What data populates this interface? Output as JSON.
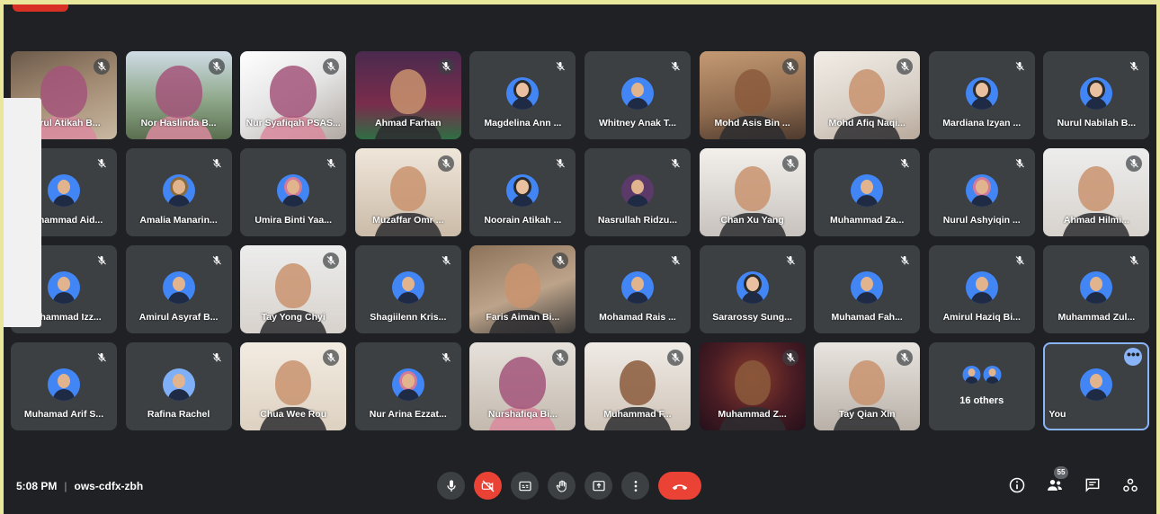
{
  "meeting": {
    "time": "5:08 PM",
    "separator": "|",
    "code": "ows-cdfx-zbh"
  },
  "participants": [
    {
      "name": "Nurul Atikah B...",
      "video": true,
      "style": "v1",
      "person": "hijab-face"
    },
    {
      "name": "Nor Haslinda B...",
      "video": true,
      "style": "v2",
      "person": "hijab-face"
    },
    {
      "name": "Nur Syafiqah PSAS...",
      "video": true,
      "style": "v3",
      "person": "hijab-face"
    },
    {
      "name": "Ahmad Farhan",
      "video": true,
      "style": "v4",
      "person": "face-light"
    },
    {
      "name": "Magdelina Ann ...",
      "video": false,
      "avatar": "hijab"
    },
    {
      "name": "Whitney Anak T...",
      "video": false,
      "avatar": "default"
    },
    {
      "name": "Mohd Asis Bin ...",
      "video": true,
      "style": "v5",
      "person": "face-dark"
    },
    {
      "name": "Mohd Afiq Naqi...",
      "video": true,
      "style": "v6",
      "person": "face"
    },
    {
      "name": "Mardiana Izyan ...",
      "video": false,
      "avatar": "hijab"
    },
    {
      "name": "Nurul Nabilah B...",
      "video": false,
      "avatar": "hijab"
    },
    {
      "name": "Muhammad Aid...",
      "video": false,
      "avatar": "default"
    },
    {
      "name": "Amalia Manarin...",
      "video": false,
      "avatar": "brown"
    },
    {
      "name": "Umira Binti Yaa...",
      "video": false,
      "avatar": "pink"
    },
    {
      "name": "Muzaffar Omr ...",
      "video": true,
      "style": "v7",
      "person": "face"
    },
    {
      "name": "Noorain Atikah ...",
      "video": false,
      "avatar": "hijab"
    },
    {
      "name": "Nasrullah Ridzu...",
      "video": false,
      "avatar": "purple"
    },
    {
      "name": "Chan Xu Yang",
      "video": true,
      "style": "v8",
      "person": "face"
    },
    {
      "name": "Muhammad Za...",
      "video": false,
      "avatar": "default"
    },
    {
      "name": "Nurul Ashyiqin ...",
      "video": false,
      "avatar": "pink"
    },
    {
      "name": "Ahmad Hilmi...",
      "video": true,
      "style": "v9",
      "person": "face"
    },
    {
      "name": "Muhammad Izz...",
      "video": false,
      "avatar": "default"
    },
    {
      "name": "Amirul Asyraf B...",
      "video": false,
      "avatar": "default"
    },
    {
      "name": "Tay Yong Chyi",
      "video": true,
      "style": "v9",
      "person": "face"
    },
    {
      "name": "Shagiilenn Kris...",
      "video": false,
      "avatar": "default"
    },
    {
      "name": "Faris Aiman Bi...",
      "video": true,
      "style": "v10",
      "person": "face"
    },
    {
      "name": "Mohamad Rais ...",
      "video": false,
      "avatar": "default"
    },
    {
      "name": "Sararossy Sung...",
      "video": false,
      "avatar": "hijab"
    },
    {
      "name": "Muhamad Fah...",
      "video": false,
      "avatar": "default"
    },
    {
      "name": "Amirul Haziq Bi...",
      "video": false,
      "avatar": "default"
    },
    {
      "name": "Muhammad Zul...",
      "video": false,
      "avatar": "default"
    },
    {
      "name": "Muhamad Arif S...",
      "video": false,
      "avatar": "default"
    },
    {
      "name": "Rafina Rachel",
      "video": false,
      "avatar": "light"
    },
    {
      "name": "Chua Wee Rou",
      "video": true,
      "style": "v11",
      "person": "face"
    },
    {
      "name": "Nur Arina Ezzat...",
      "video": false,
      "avatar": "pink"
    },
    {
      "name": "Nurshafiqa Bi...",
      "video": true,
      "style": "v12",
      "person": "hijab-face"
    },
    {
      "name": "Muhammad F...",
      "video": true,
      "style": "v14",
      "person": "face-dark"
    },
    {
      "name": "Muhammad Z...",
      "video": true,
      "style": "v13",
      "person": "face-dark"
    },
    {
      "name": "Tay Qian Xin",
      "video": true,
      "style": "v15",
      "person": "face"
    }
  ],
  "others_tile": {
    "label": "16 others"
  },
  "self_tile": {
    "name": "You",
    "more_glyph": "•••"
  },
  "toolbar": {
    "participants_badge": "55"
  },
  "icons": {
    "mic": "mic-icon",
    "camera_off": "camera-off-icon",
    "captions": "captions-icon",
    "raise_hand": "raise-hand-icon",
    "present": "present-screen-icon",
    "more": "more-options-icon",
    "hangup": "hang-up-icon",
    "info": "info-icon",
    "people": "people-icon",
    "chat": "chat-icon",
    "activities": "activities-icon"
  },
  "colors": {
    "background": "#202124",
    "tile": "#3c4043",
    "danger": "#ea4335",
    "accent": "#8ab4f8"
  }
}
